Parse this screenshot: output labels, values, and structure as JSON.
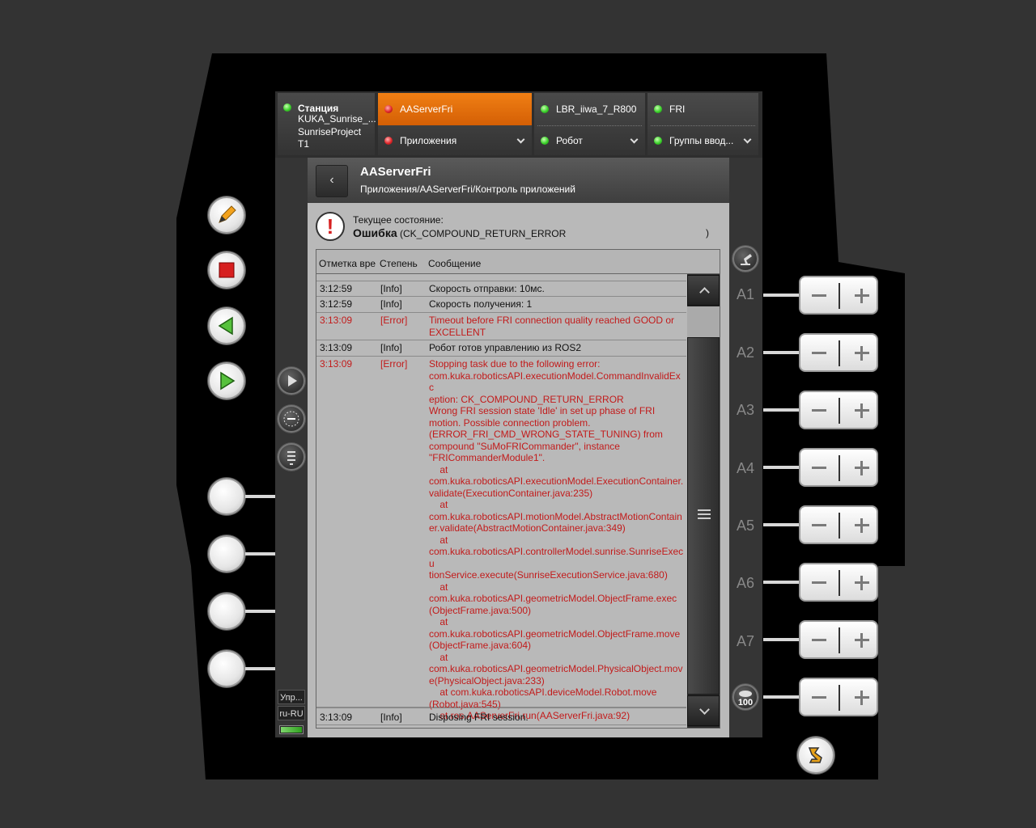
{
  "topbar": {
    "station": {
      "title": "Станция",
      "line1": "KUKA_Sunrise_...",
      "line2": "SunriseProject",
      "line3": "T1"
    },
    "app": {
      "name": "AAServerFri",
      "section": "Приложения"
    },
    "robot": {
      "name": "LBR_iiwa_7_R800",
      "section": "Робот"
    },
    "fri": {
      "name": "FRI",
      "section": "Группы ввод..."
    }
  },
  "header": {
    "back": "‹",
    "title": "AAServerFri",
    "path": "Приложения/AAServerFri/Контроль приложений"
  },
  "state": {
    "icon": "!",
    "label": "Текущее состояние:",
    "value_bold": "Ошибка",
    "value_rest": "(CK_COMPOUND_RETURN_ERROR",
    "close": ")"
  },
  "log": {
    "columns": [
      "Отметка вре",
      "Степень",
      "Сообщение"
    ],
    "rows": [
      {
        "time": "3:12:59",
        "level": "[Info]",
        "msg": "Скорость отправки: 10мс."
      },
      {
        "time": "3:12:59",
        "level": "[Info]",
        "msg": "Скорость получения: 1"
      },
      {
        "time": "3:13:09",
        "level": "[Error]",
        "msg": "Timeout before FRI connection quality reached GOOD or\nEXCELLENT"
      },
      {
        "time": "3:13:09",
        "level": "[Info]",
        "msg": "Робот готов управлению из ROS2"
      },
      {
        "time": "3:13:09",
        "level": "[Error]",
        "msg": "Stopping task due to the following error:\ncom.kuka.roboticsAPI.executionModel.CommandInvalidExc\neption: CK_COMPOUND_RETURN_ERROR\nWrong FRI session state 'Idle' in set up phase of FRI\nmotion. Possible connection problem.\n(ERROR_FRI_CMD_WRONG_STATE_TUNING) from\ncompound \"SuMoFRICommander\", instance\n\"FRICommanderModule1\".\n    at\ncom.kuka.roboticsAPI.executionModel.ExecutionContainer.\nvalidate(ExecutionContainer.java:235)\n    at\ncom.kuka.roboticsAPI.motionModel.AbstractMotionContain\ner.validate(AbstractMotionContainer.java:349)\n    at\ncom.kuka.roboticsAPI.controllerModel.sunrise.SunriseExecu\ntionService.execute(SunriseExecutionService.java:680)\n    at\ncom.kuka.roboticsAPI.geometricModel.ObjectFrame.exec\n(ObjectFrame.java:500)\n    at\ncom.kuka.roboticsAPI.geometricModel.ObjectFrame.move\n(ObjectFrame.java:604)\n    at\ncom.kuka.roboticsAPI.geometricModel.PhysicalObject.mov\ne(PhysicalObject.java:233)\n    at com.kuka.roboticsAPI.deviceModel.Robot.move\n(Robot.java:545)\n    at ros.AAServerFri.run(AAServerFri.java:92)"
      },
      {
        "time": "3:13:09",
        "level": "[Info]",
        "msg": "Disposing FRI session."
      }
    ]
  },
  "axes": [
    "A1",
    "A2",
    "A3",
    "A4",
    "A5",
    "A6",
    "A7"
  ],
  "override": "100",
  "indicators": {
    "mode": "Упр...",
    "lang": "ru-RU"
  },
  "colors": {
    "accent": "#e8700a",
    "error_text": "#c21b1b",
    "led_green": "#3ad12a",
    "led_red": "#e0262a"
  }
}
